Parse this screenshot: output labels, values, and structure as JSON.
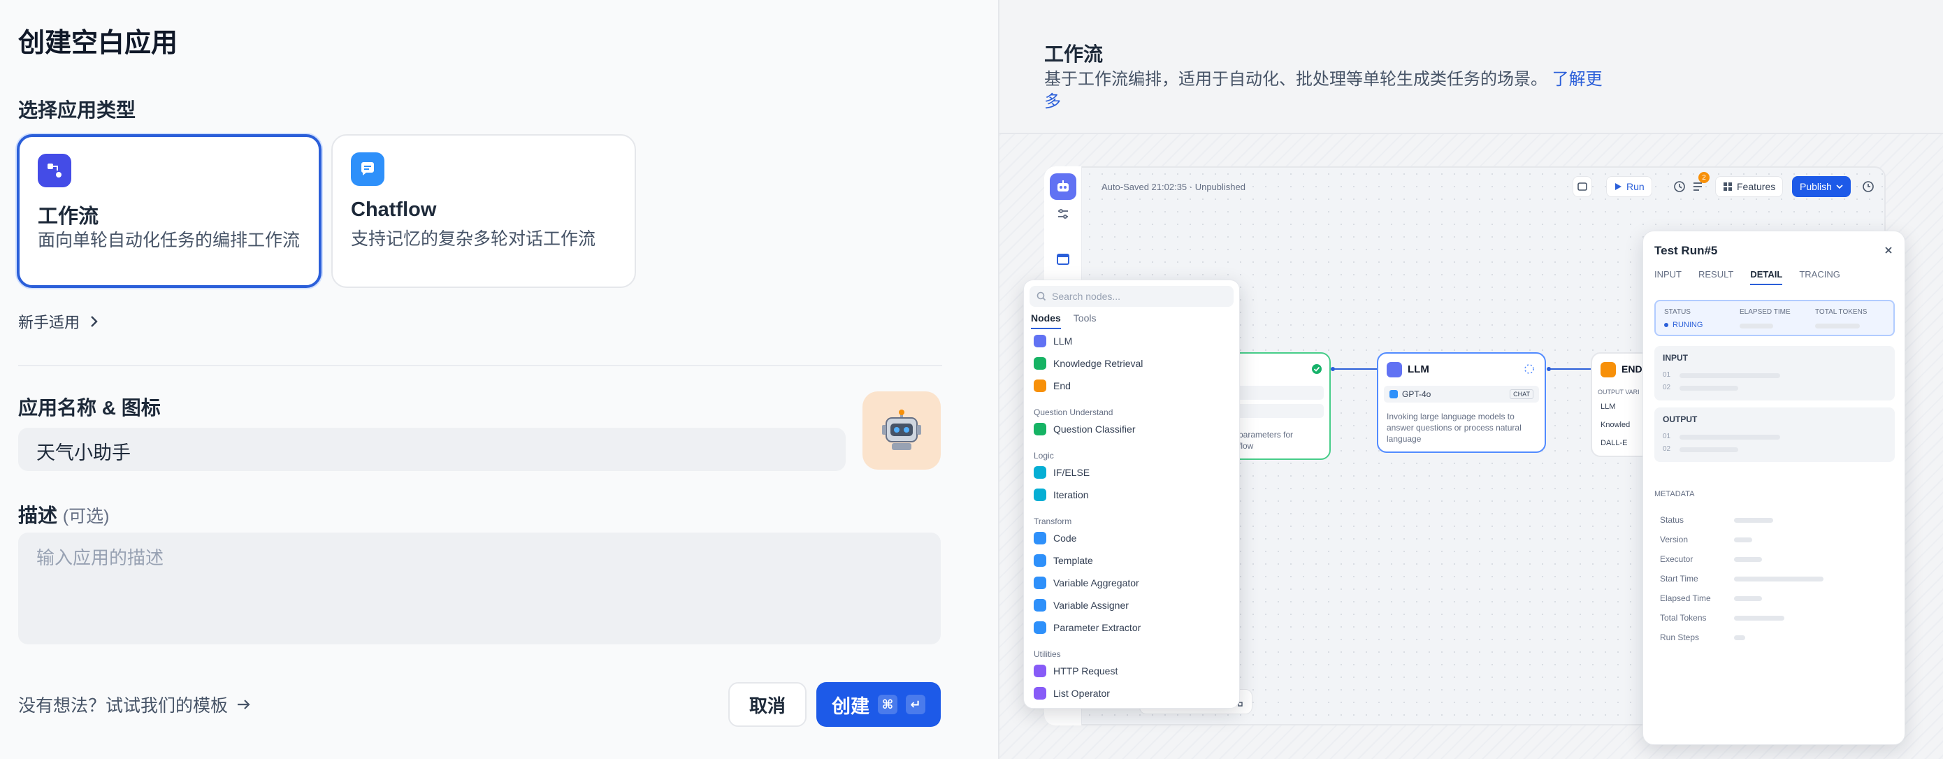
{
  "page_title": "创建空白应用",
  "type_section": {
    "label": "选择应用类型",
    "cards": [
      {
        "title": "工作流",
        "desc": "面向单轮自动化任务的编排工作流",
        "selected": true,
        "icon": "workflow-icon",
        "color": "#444ce7"
      },
      {
        "title": "Chatflow",
        "desc": "支持记忆的复杂多轮对话工作流",
        "selected": false,
        "icon": "chatflow-icon",
        "color": "#2e90fa"
      }
    ],
    "newbie_label": "新手适用"
  },
  "name_section": {
    "label": "应用名称 & 图标",
    "value": "天气小助手",
    "avatar_icon": "robot-icon"
  },
  "desc_section": {
    "label": "描述",
    "optional": "(可选)",
    "placeholder": "输入应用的描述"
  },
  "footer": {
    "template_link": "没有想法？试试我们的模板",
    "cancel": "取消",
    "create": "创建",
    "kbd_cmd": "⌘",
    "kbd_enter": "↵"
  },
  "preview": {
    "title": "工作流",
    "desc": "基于工作流编排，适用于自动化、批处理等单轮生成类任务的场景。",
    "learn_more": "了解更多",
    "autosave": "Auto-Saved 21:02:35 · Unpublished",
    "toolbar": {
      "run": "Run",
      "features": "Features",
      "publish": "Publish",
      "badge": "2"
    },
    "llm_node": {
      "title": "LLM",
      "model": "GPT-4o",
      "mode": "CHAT",
      "desc": "Invoking large language models to answer questions or process natural language"
    },
    "start_node": {
      "frag": "parameters for",
      "frag2": "flow"
    },
    "end_node": {
      "title": "END",
      "output": "OUTPUT VARI",
      "vars": [
        "LLM",
        "Knowled",
        "DALL-E"
      ]
    },
    "node_menu": {
      "search": "Search nodes...",
      "tabs": [
        "Nodes",
        "Tools"
      ],
      "items": [
        {
          "label": "LLM",
          "color": "#6172f3"
        },
        {
          "label": "Knowledge Retrieval",
          "color": "#16b364"
        },
        {
          "label": "End",
          "color": "#f79009"
        },
        {
          "group": "Question Understand"
        },
        {
          "label": "Question Classifier",
          "color": "#16b364"
        },
        {
          "group": "Logic"
        },
        {
          "label": "IF/ELSE",
          "color": "#06aed4"
        },
        {
          "label": "Iteration",
          "color": "#06aed4"
        },
        {
          "group": "Transform"
        },
        {
          "label": "Code",
          "color": "#2e90fa"
        },
        {
          "label": "Template",
          "color": "#2e90fa"
        },
        {
          "label": "Variable Aggregator",
          "color": "#2e90fa"
        },
        {
          "label": "Variable Assigner",
          "color": "#2e90fa"
        },
        {
          "label": "Parameter Extractor",
          "color": "#2e90fa"
        },
        {
          "group": "Utilities"
        },
        {
          "label": "HTTP Request",
          "color": "#875bf7"
        },
        {
          "label": "List Operator",
          "color": "#875bf7"
        }
      ]
    },
    "run_panel": {
      "title": "Test Run#5",
      "tabs": [
        "INPUT",
        "RESULT",
        "DETAIL",
        "TRACING"
      ],
      "active_tab": "DETAIL",
      "status_label": "STATUS",
      "status_value": "RUNING",
      "elapsed_label": "ELAPSED TIME",
      "tokens_label": "TOTAL TOKENS",
      "input_label": "INPUT",
      "output_label": "OUTPUT",
      "line1": "01",
      "line2": "02",
      "metadata_label": "METADATA",
      "meta": [
        "Status",
        "Version",
        "Executor",
        "Start Time",
        "Elapsed Time",
        "Total Tokens",
        "Run Steps"
      ]
    }
  }
}
